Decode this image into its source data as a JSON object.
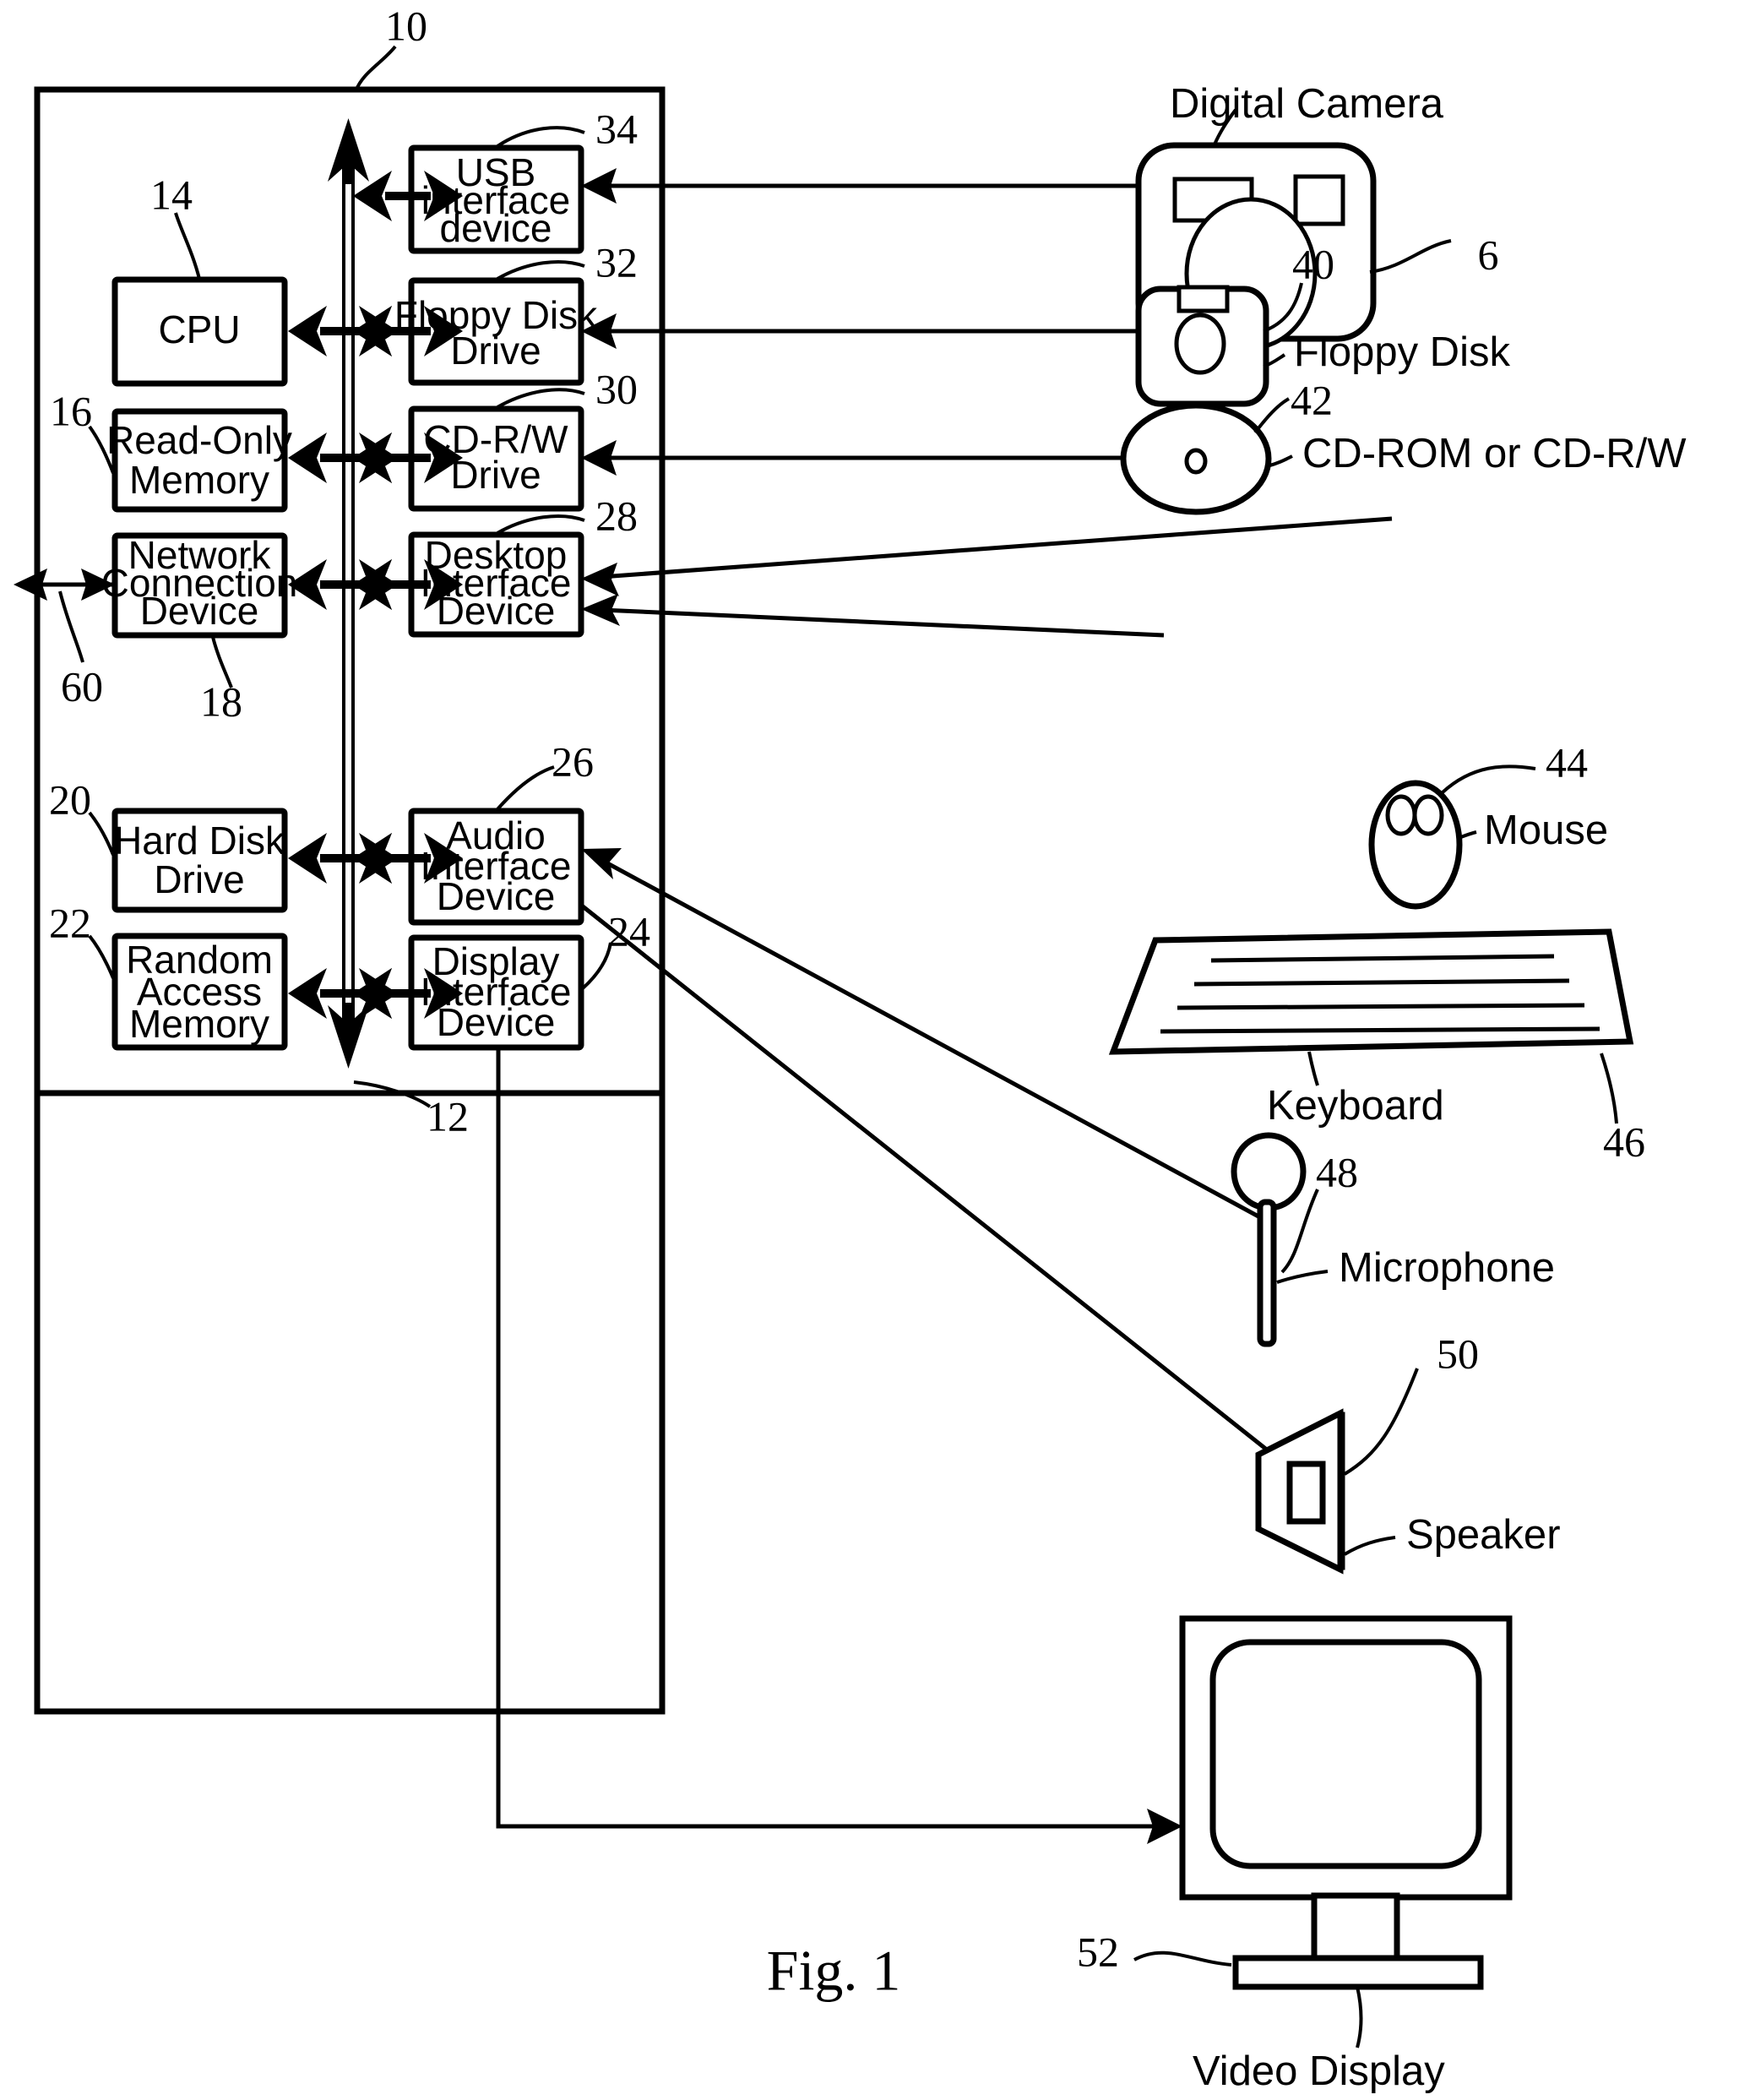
{
  "figure": {
    "caption": "Fig. 1",
    "system_ref": "10",
    "bus_ref": "12",
    "network_link_ref": "60"
  },
  "internal_blocks": [
    {
      "id": "cpu",
      "label": "CPU",
      "ref": "14"
    },
    {
      "id": "rom",
      "label": "Read-Only\nMemory",
      "ref": "16"
    },
    {
      "id": "netdev",
      "label": "Network\nConnection\nDevice",
      "ref": "18"
    },
    {
      "id": "hdd",
      "label": "Hard Disk\nDrive",
      "ref": "20"
    },
    {
      "id": "ram",
      "label": "Random\nAccess\nMemory",
      "ref": "22"
    },
    {
      "id": "usb",
      "label": "USB\ninterface\ndevice",
      "ref": "34"
    },
    {
      "id": "fdd",
      "label": "Floppy Disk\nDrive",
      "ref": "32"
    },
    {
      "id": "cdrw",
      "label": "CD-R/W\nDrive",
      "ref": "30"
    },
    {
      "id": "desktop",
      "label": "Desktop\nInterface\nDevice",
      "ref": "28"
    },
    {
      "id": "audio",
      "label": "Audio\nInterface\nDevice",
      "ref": "26"
    },
    {
      "id": "display",
      "label": "Display\nInterface\nDevice",
      "ref": "24"
    }
  ],
  "box_text": {
    "cpu_l1": "CPU",
    "rom_l1": "Read-Only",
    "rom_l2": "Memory",
    "net_l1": "Network",
    "net_l2": "Connection",
    "net_l3": "Device",
    "hdd_l1": "Hard Disk",
    "hdd_l2": "Drive",
    "ram_l1": "Random",
    "ram_l2": "Access",
    "ram_l3": "Memory",
    "usb_l1": "USB",
    "usb_l2": "interface",
    "usb_l3": "device",
    "fdd_l1": "Floppy Disk",
    "fdd_l2": "Drive",
    "cdrw_l1": "CD-R/W",
    "cdrw_l2": "Drive",
    "desk_l1": "Desktop",
    "desk_l2": "Interface",
    "desk_l3": "Device",
    "audio_l1": "Audio",
    "audio_l2": "Interface",
    "audio_l3": "Device",
    "disp_l1": "Display",
    "disp_l2": "Interface",
    "disp_l3": "Device"
  },
  "peripherals": [
    {
      "id": "camera",
      "label": "Digital Camera",
      "ref": "6"
    },
    {
      "id": "floppy",
      "label": "Floppy Disk",
      "ref": "40"
    },
    {
      "id": "cd",
      "label": "CD-ROM or CD-R/W",
      "ref": "42"
    },
    {
      "id": "mouse",
      "label": "Mouse",
      "ref": "44"
    },
    {
      "id": "keyboard",
      "label": "Keyboard",
      "ref": "46"
    },
    {
      "id": "mic",
      "label": "Microphone",
      "ref": "48"
    },
    {
      "id": "speaker",
      "label": "Speaker",
      "ref": "50"
    },
    {
      "id": "monitor",
      "label": "Video Display",
      "ref": "52"
    }
  ],
  "peripheral_text": {
    "camera": "Digital Camera",
    "floppy": "Floppy Disk",
    "cd": "CD-ROM or CD-R/W",
    "mouse": "Mouse",
    "keyboard": "Keyboard",
    "mic": "Microphone",
    "speaker": "Speaker",
    "monitor": "Video Display"
  },
  "ref_numbers": {
    "n6": "6",
    "n10": "10",
    "n12": "12",
    "n14": "14",
    "n16": "16",
    "n18": "18",
    "n20": "20",
    "n22": "22",
    "n24": "24",
    "n26": "26",
    "n28": "28",
    "n30": "30",
    "n32": "32",
    "n34": "34",
    "n40": "40",
    "n42": "42",
    "n44": "44",
    "n46": "46",
    "n48": "48",
    "n50": "50",
    "n52": "52",
    "n60": "60"
  },
  "colors": {
    "ink": "#000000",
    "paper": "#ffffff"
  }
}
